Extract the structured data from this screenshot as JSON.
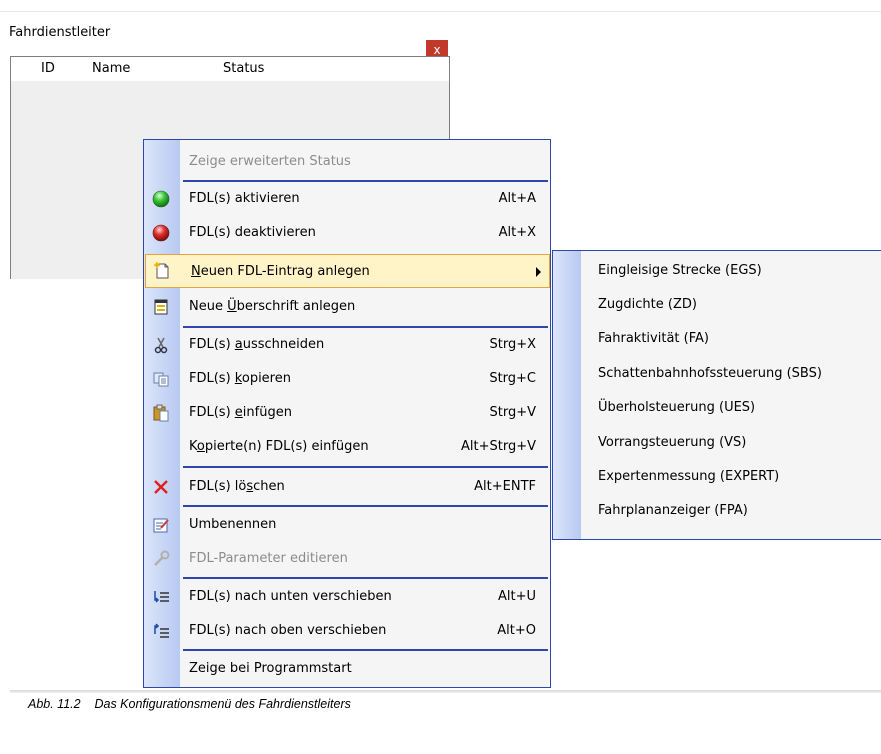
{
  "window": {
    "title": "Fahrdienstleiter",
    "close_label": "x",
    "columns": [
      "ID",
      "Name",
      "Status"
    ]
  },
  "menu": {
    "items": [
      {
        "label": "Zeige erweiterten Status",
        "shortcut": "",
        "disabled": true,
        "icon": "none"
      },
      {
        "label": "FDL(s) aktivieren",
        "shortcut": "Alt+A",
        "icon": "green-ball-icon"
      },
      {
        "label": "FDL(s) deaktivieren",
        "shortcut": "Alt+X",
        "icon": "red-ball-icon"
      },
      {
        "label_pre": "",
        "label_u": "N",
        "label_post": "euen FDL-Eintrag anlegen",
        "shortcut": "",
        "icon": "new-document-icon",
        "selected": true,
        "submenu": true
      },
      {
        "label_pre": "Neue ",
        "label_u": "Ü",
        "label_post": "berschrift anlegen",
        "shortcut": "",
        "icon": "heading-icon"
      },
      {
        "label_pre": "FDL(s) ",
        "label_u": "a",
        "label_post": "usschneiden",
        "shortcut": "Strg+X",
        "icon": "scissors-icon"
      },
      {
        "label_pre": "FDL(s) ",
        "label_u": "k",
        "label_post": "opieren",
        "shortcut": "Strg+C",
        "icon": "copy-icon"
      },
      {
        "label_pre": "FDL(s) ",
        "label_u": "e",
        "label_post": "infügen",
        "shortcut": "Strg+V",
        "icon": "paste-icon"
      },
      {
        "label_pre": "K",
        "label_u": "o",
        "label_post": "pierte(n) FDL(s) einfügen",
        "shortcut": "Alt+Strg+V",
        "icon": "none"
      },
      {
        "label_pre": "FDL(s) lö",
        "label_u": "s",
        "label_post": "chen",
        "shortcut": "Alt+ENTF",
        "icon": "delete-icon"
      },
      {
        "label": "Umbenennen",
        "shortcut": "",
        "icon": "rename-icon"
      },
      {
        "label": "FDL-Parameter editieren",
        "shortcut": "",
        "disabled": true,
        "icon": "wrench-icon"
      },
      {
        "label": "FDL(s) nach unten verschieben",
        "shortcut": "Alt+U",
        "icon": "move-down-icon"
      },
      {
        "label": "FDL(s) nach oben verschieben",
        "shortcut": "Alt+O",
        "icon": "move-up-icon"
      },
      {
        "label": "Zeige bei Programmstart",
        "shortcut": "",
        "icon": "none"
      }
    ]
  },
  "submenu": {
    "items": [
      "Eingleisige Strecke (EGS)",
      "Zugdichte (ZD)",
      "Fahraktivität (FA)",
      "Schattenbahnhofssteuerung (SBS)",
      "Überholsteuerung (UES)",
      "Vorrangsteuerung (VS)",
      "Expertenmessung (EXPERT)",
      "Fahrplananzeiger (FPA)"
    ]
  },
  "caption": "Abb. 11.2    Das Konfigurationsmenü des Fahrdienstleiters",
  "colors": {
    "menu_border": "#2e47a8",
    "selected_bg": "#fff3c8",
    "selected_border": "#e5a43c",
    "close_button": "#c0392b"
  }
}
